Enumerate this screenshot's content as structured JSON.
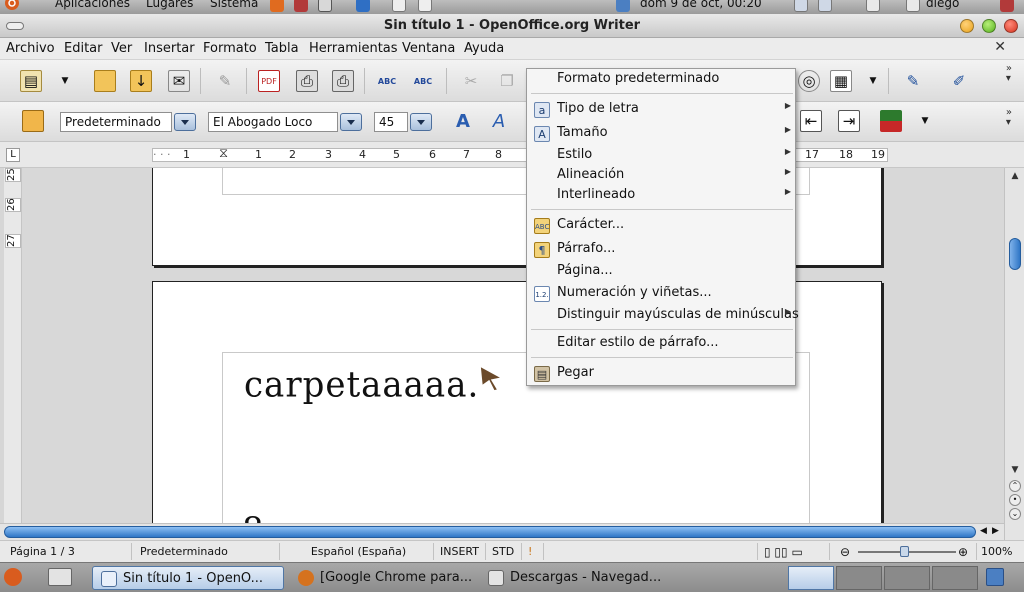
{
  "top_panel": {
    "menus": [
      "Aplicaciones",
      "Lugares",
      "Sistema"
    ],
    "clock": "dom  9 de oct, 00:20",
    "user": "diego"
  },
  "window": {
    "title": "Sin título 1 - OpenOffice.org Writer"
  },
  "menubar": {
    "items": [
      "Archivo",
      "Editar",
      "Ver",
      "Insertar",
      "Formato",
      "Tabla",
      "Herramientas",
      "Ventana",
      "Ayuda"
    ]
  },
  "formatting": {
    "paragraph_style": "Predeterminado",
    "font_name": "El Abogado Loco",
    "font_size": "45"
  },
  "ruler": {
    "ticks": [
      "1",
      "1",
      "2",
      "3",
      "4",
      "5",
      "6",
      "7",
      "8",
      "17",
      "18",
      "19"
    ],
    "vticks": [
      "25",
      "26",
      "27"
    ]
  },
  "document": {
    "visible_text": "carpetaaaaa."
  },
  "context_menu": {
    "items": [
      {
        "label": "Formato predeterminado",
        "icon": "none",
        "submenu": false
      },
      {
        "label": "Tipo de letra",
        "icon": "font-icon",
        "submenu": true
      },
      {
        "label": "Tamaño",
        "icon": "font-size-icon",
        "submenu": true
      },
      {
        "label": "Estilo",
        "icon": "none",
        "submenu": true
      },
      {
        "label": "Alineación",
        "icon": "none",
        "submenu": true
      },
      {
        "label": "Interlineado",
        "icon": "none",
        "submenu": true
      },
      {
        "label": "Carácter...",
        "icon": "character-icon",
        "submenu": false
      },
      {
        "label": "Párrafo...",
        "icon": "paragraph-icon",
        "submenu": false
      },
      {
        "label": "Página...",
        "icon": "none",
        "submenu": false
      },
      {
        "label": "Numeración y viñetas...",
        "icon": "numbering-icon",
        "submenu": false
      },
      {
        "label": "Distinguir mayúsculas de minúsculas",
        "icon": "none",
        "submenu": true
      },
      {
        "label": "Editar estilo de párrafo...",
        "icon": "none",
        "submenu": false
      },
      {
        "label": "Pegar",
        "icon": "paste-icon",
        "submenu": false
      }
    ]
  },
  "statusbar": {
    "page": "Página  1 / 3",
    "style": "Predeterminado",
    "language": "Español (España)",
    "insert_mode": "INSERT",
    "selection_mode": "STD",
    "zoom": "100%"
  },
  "taskbar": {
    "tasks": [
      {
        "label": "Sin título 1 - OpenO...",
        "active": true
      },
      {
        "label": "[Google Chrome para...",
        "active": false
      },
      {
        "label": "Descargas - Navegad...",
        "active": false
      }
    ]
  },
  "colors": {
    "selection_blue": "#3a7bd5",
    "menu_bg": "#f5f5f5",
    "panel_gray": "#a0a0a0"
  }
}
